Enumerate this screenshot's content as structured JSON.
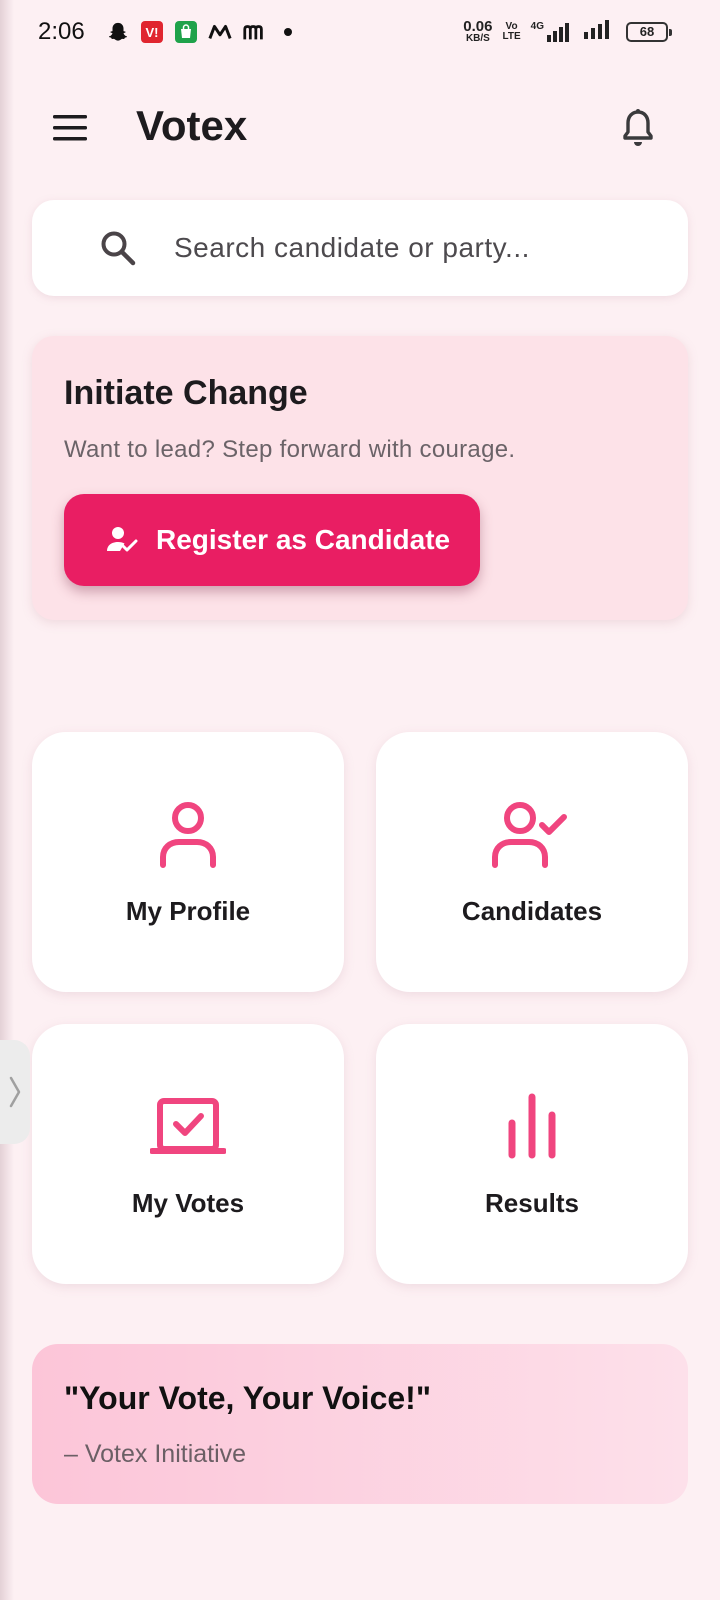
{
  "status_bar": {
    "time": "2:06",
    "net_speed": "0.06",
    "net_unit": "KB/S",
    "volte_top": "Vo",
    "volte_bottom": "LTE",
    "network": "4G",
    "battery": "68",
    "notification_icons": [
      "snapchat-icon",
      "vi-app-icon",
      "shopping-bag-icon",
      "myntra-icon",
      "meesho-icon",
      "more-dot-icon"
    ]
  },
  "app_bar": {
    "title": "Votex",
    "menu_icon": "hamburger-menu-icon",
    "notification_icon": "bell-icon"
  },
  "search": {
    "placeholder": "Search candidate or party..."
  },
  "initiate": {
    "title": "Initiate Change",
    "subtitle": "Want to lead? Step forward with courage.",
    "button_label": "Register as Candidate"
  },
  "tiles": [
    {
      "label": "My Profile",
      "icon": "person-icon"
    },
    {
      "label": "Candidates",
      "icon": "person-check-icon"
    },
    {
      "label": "My Votes",
      "icon": "ballot-box-icon"
    },
    {
      "label": "Results",
      "icon": "bar-chart-icon"
    }
  ],
  "quote": {
    "text": "\"Your Vote, Your Voice!\"",
    "author": "– Votex Initiative"
  },
  "colors": {
    "accent": "#e91e63",
    "icon_pink": "#f0457f",
    "background": "#fdf0f3",
    "card_pink": "#fde2e8"
  }
}
